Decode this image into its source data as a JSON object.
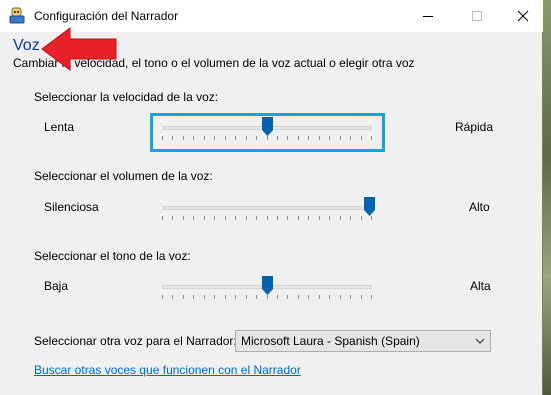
{
  "window": {
    "title": "Configuración del Narrador",
    "icon": "narrator-app-icon"
  },
  "heading": "Voz",
  "subheading": "Cambiar la velocidad, el tono o el volumen de la voz actual o elegir otra voz",
  "annotation": {
    "icon": "red-arrow-icon",
    "color": "#e8202a"
  },
  "speed": {
    "label": "Seleccionar la velocidad de la voz:",
    "min_label": "Lenta",
    "max_label": "Rápida",
    "value": 0.5,
    "focused": true
  },
  "volume": {
    "label": "Seleccionar el volumen de la voz:",
    "min_label": "Silenciosa",
    "max_label": "Alto",
    "value": 1.0
  },
  "pitch": {
    "label": "Seleccionar el tono de la voz:",
    "min_label": "Baja",
    "max_label": "Alta",
    "value": 0.5
  },
  "voice": {
    "label": "Seleccionar otra voz para el Narrador:",
    "selected": "Microsoft Laura - Spanish (Spain)"
  },
  "link": "Buscar otras voces que funcionen con el Narrador",
  "colors": {
    "accent": "#0063b1",
    "focus": "#12a3e0",
    "heading": "#0a3aa0",
    "link": "#0066cc"
  }
}
